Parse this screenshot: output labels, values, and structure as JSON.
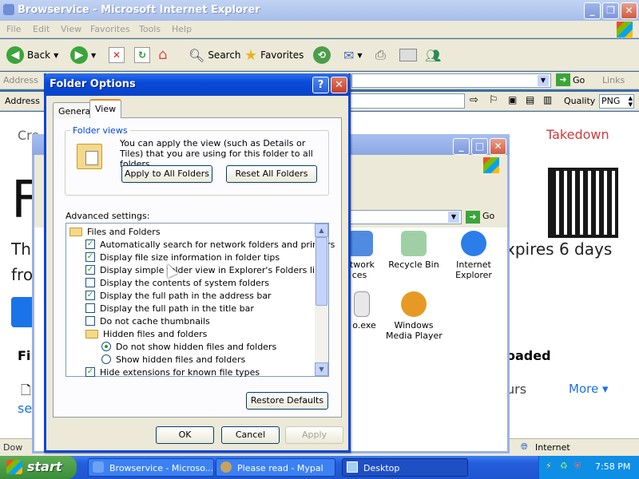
{
  "ie": {
    "title": "Browservice - Microsoft Internet Explorer",
    "menu": [
      "File",
      "Edit",
      "View",
      "Favorites",
      "Tools",
      "Help"
    ],
    "toolbar": {
      "back": "Back",
      "search": "Search",
      "favorites": "Favorites"
    },
    "address_label": "Address",
    "go_label": "Go",
    "links_label": "Links",
    "address2_label": "Address",
    "quality_label": "Quality",
    "quality_value": "PNG",
    "status_zone": "Internet",
    "status_left": "Dow"
  },
  "page": {
    "cre": "Cre",
    "takedown": "Takedown",
    "big_f": "F",
    "th": "Th",
    "fro": "fro",
    "expires": "xpires 6 days",
    "fi": "Fi",
    "oaded": "oaded",
    "urs": "urs",
    "more": "More",
    "se": "se"
  },
  "explorer": {
    "go_label": "Go",
    "icons": [
      {
        "label": "etwork\nces",
        "icon": "network-icon"
      },
      {
        "label": "Recycle Bin",
        "icon": "recycle-bin-icon"
      },
      {
        "label": "Internet\nExplorer",
        "icon": "ie-icon"
      },
      {
        "label": "o.exe",
        "icon": "exe-icon"
      },
      {
        "label": "Windows\nMedia Player",
        "icon": "media-player-icon"
      }
    ]
  },
  "dialog": {
    "title": "Folder Options",
    "tabs": [
      "General",
      "View"
    ],
    "folder_views_legend": "Folder views",
    "folder_views_text": "You can apply the view (such as Details or Tiles) that you are using for this folder to all folders.",
    "apply_all": "Apply to All Folders",
    "reset_all": "Reset All Folders",
    "advanced_label": "Advanced settings:",
    "settings": [
      {
        "type": "folder",
        "label": "Files and Folders",
        "indent": 0
      },
      {
        "type": "check",
        "label": "Automatically search for network folders and printers",
        "checked": true,
        "indent": 1
      },
      {
        "type": "check",
        "label": "Display file size information in folder tips",
        "checked": true,
        "indent": 1
      },
      {
        "type": "check",
        "label": "Display simple folder view in Explorer's Folders list",
        "checked": true,
        "indent": 1
      },
      {
        "type": "check",
        "label": "Display the contents of system folders",
        "checked": false,
        "indent": 1
      },
      {
        "type": "check",
        "label": "Display the full path in the address bar",
        "checked": true,
        "indent": 1
      },
      {
        "type": "check",
        "label": "Display the full path in the title bar",
        "checked": false,
        "indent": 1
      },
      {
        "type": "check",
        "label": "Do not cache thumbnails",
        "checked": false,
        "indent": 1
      },
      {
        "type": "folder",
        "label": "Hidden files and folders",
        "indent": 1
      },
      {
        "type": "radio",
        "label": "Do not show hidden files and folders",
        "checked": true,
        "indent": 2
      },
      {
        "type": "radio",
        "label": "Show hidden files and folders",
        "checked": false,
        "indent": 2
      },
      {
        "type": "check",
        "label": "Hide extensions for known file types",
        "checked": true,
        "indent": 1
      }
    ],
    "restore_defaults": "Restore Defaults",
    "ok": "OK",
    "cancel": "Cancel",
    "apply": "Apply"
  },
  "taskbar": {
    "start": "start",
    "tasks": [
      "Browservice - Microso...",
      "Please read - Mypal",
      "Desktop"
    ],
    "clock": "7:58 PM"
  }
}
